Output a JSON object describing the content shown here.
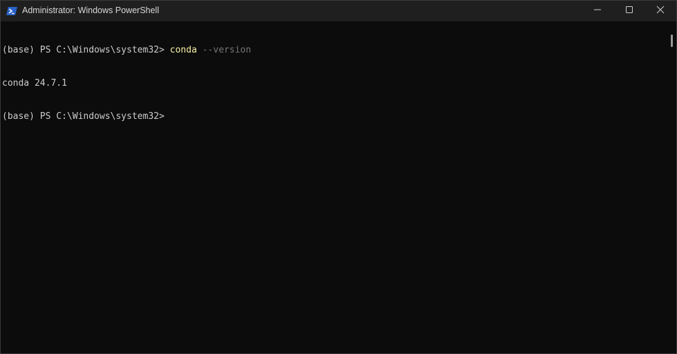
{
  "window": {
    "title": "Administrator: Windows PowerShell",
    "app_icon": "powershell-icon",
    "controls": {
      "minimize_icon": "minimize-icon",
      "maximize_icon": "maximize-icon",
      "close_icon": "close-icon"
    }
  },
  "terminal": {
    "lines": [
      {
        "prompt": "(base) PS C:\\Windows\\system32> ",
        "command": "conda",
        "argument": " --version"
      },
      {
        "output": "conda 24.7.1"
      },
      {
        "prompt": "(base) PS C:\\Windows\\system32>"
      }
    ]
  },
  "colors": {
    "background": "#0c0c0c",
    "titlebar": "#1f1f1f",
    "text": "#cccccc",
    "command": "#f9f1a5",
    "parameter": "#767676",
    "icon_accent": "#2a62c9"
  }
}
